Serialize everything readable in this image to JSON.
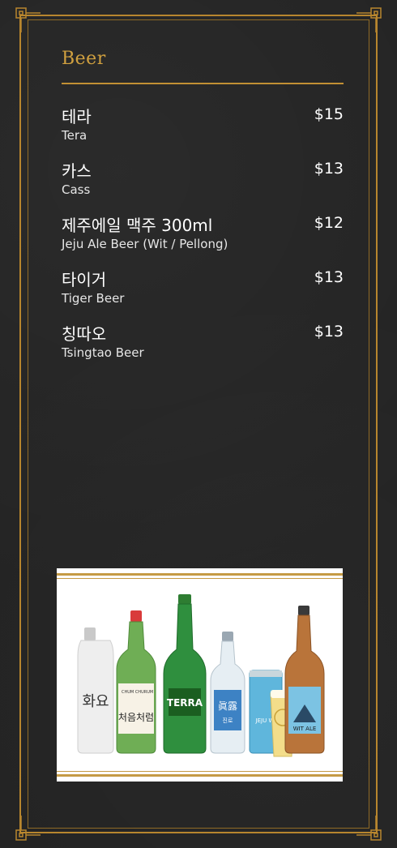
{
  "menu": {
    "section_title": "Beer",
    "items": [
      {
        "name_ko": "테라",
        "name_en": "Tera",
        "price": "$15"
      },
      {
        "name_ko": "카스",
        "name_en": "Cass",
        "price": "$13"
      },
      {
        "name_ko": "제주에일 맥주 300ml",
        "name_en": "Jeju Ale Beer (Wit / Pellong)",
        "price": "$12"
      },
      {
        "name_ko": "타이거",
        "name_en": "Tiger Beer",
        "price": "$13"
      },
      {
        "name_ko": "칭따오",
        "name_en": "Tsingtao Beer",
        "price": "$13"
      }
    ]
  },
  "photo": {
    "labels": {
      "hwayo": "화요",
      "chum_churum": "CHUM CHURUM",
      "chum_churum_ko": "처음처럼",
      "terra": "TERRA",
      "jinro": "眞露",
      "jinro_ko": "진로",
      "jeju_can": "JEJU WI",
      "jeju_bottle": "WIT ALE"
    }
  },
  "colors": {
    "background": "#232323",
    "gold": "#c29034",
    "text": "#ffffff"
  }
}
